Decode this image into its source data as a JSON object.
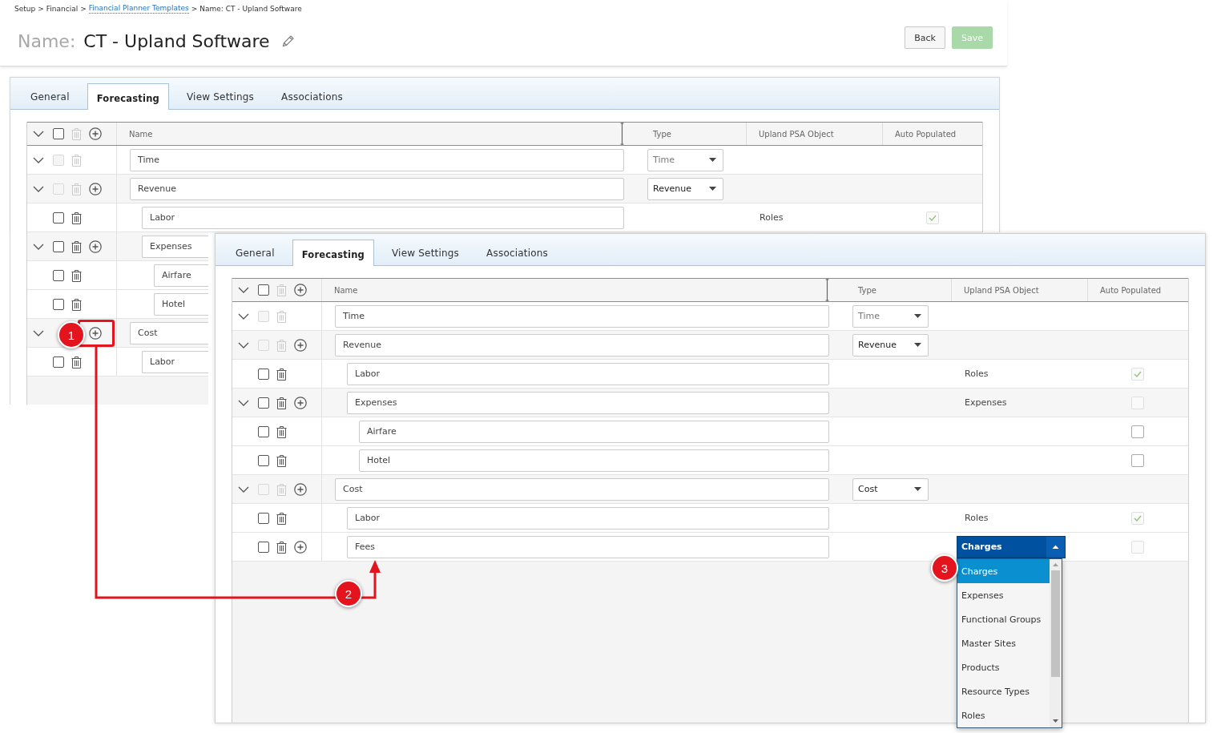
{
  "breadcrumb": [
    {
      "kind": "text",
      "text": "Setup"
    },
    {
      "kind": "separator",
      "text": ">"
    },
    {
      "kind": "text",
      "text": "Financial"
    },
    {
      "kind": "separator",
      "text": ">"
    },
    {
      "kind": "link",
      "text": "Financial Planner Templates"
    },
    {
      "kind": "separator",
      "text": ">"
    },
    {
      "kind": "text",
      "text": "Name: CT - Upland Software"
    }
  ],
  "title": {
    "label": "Name:",
    "value": "CT - Upland Software"
  },
  "buttons": [
    {
      "label": "Back",
      "kind": "secondary",
      "disabled": false
    },
    {
      "label": "Save",
      "kind": "primary",
      "disabled": true
    }
  ],
  "panels": [
    {
      "tabs": [
        {
          "label": "General",
          "selected": false
        },
        {
          "label": "Forecasting",
          "selected": true
        },
        {
          "label": "View Settings",
          "selected": false
        },
        {
          "label": "Associations",
          "selected": false
        }
      ],
      "columns": [
        "Name",
        "Type",
        "Upland PSA Object",
        "Auto Populated"
      ],
      "header_controls": {
        "expanded": true,
        "checkbox": {
          "checked": false,
          "disabled": false
        },
        "trash": {
          "disabled": true
        },
        "add": true
      },
      "rows": [
        {
          "name": "Time",
          "expanded": true,
          "checkbox": {
            "checked": false,
            "disabled": true
          },
          "trash": {
            "disabled": true
          },
          "add": false,
          "type": {
            "value": "Time",
            "disabled": true
          }
        },
        {
          "name": "Revenue",
          "expanded": true,
          "checkbox": {
            "checked": false,
            "disabled": true
          },
          "trash": {
            "disabled": true
          },
          "add": true,
          "type": {
            "value": "Revenue",
            "disabled": false
          },
          "children": [
            {
              "name": "Labor",
              "checkbox": {
                "checked": false,
                "disabled": false
              },
              "trash": {
                "disabled": false
              },
              "add": false,
              "psa_object": "Roles",
              "auto_populated": {
                "checked": true,
                "disabled": true
              }
            },
            {
              "name": "Expenses",
              "expanded": true,
              "checkbox": {
                "checked": false,
                "disabled": false
              },
              "trash": {
                "disabled": false
              },
              "add": true,
              "children": [
                {
                  "name": "Airfare",
                  "checkbox": {
                    "checked": false,
                    "disabled": false
                  },
                  "trash": {
                    "disabled": false
                  },
                  "add": false
                },
                {
                  "name": "Hotel",
                  "checkbox": {
                    "checked": false,
                    "disabled": false
                  },
                  "trash": {
                    "disabled": false
                  },
                  "add": false
                }
              ]
            }
          ]
        },
        {
          "name": "Cost",
          "expanded": true,
          "add": true,
          "children": [
            {
              "name": "Labor",
              "checkbox": {
                "checked": false,
                "disabled": false
              },
              "trash": {
                "disabled": false
              },
              "add": false
            }
          ]
        }
      ]
    },
    {
      "tabs": [
        {
          "label": "General",
          "selected": false
        },
        {
          "label": "Forecasting",
          "selected": true
        },
        {
          "label": "View Settings",
          "selected": false
        },
        {
          "label": "Associations",
          "selected": false
        }
      ],
      "columns": [
        "Name",
        "Type",
        "Upland PSA Object",
        "Auto Populated"
      ],
      "header_controls": {
        "expanded": true,
        "checkbox": {
          "checked": false,
          "disabled": false
        },
        "trash": {
          "disabled": true
        },
        "add": true
      },
      "rows": [
        {
          "name": "Time",
          "expanded": true,
          "checkbox": {
            "checked": false,
            "disabled": true
          },
          "trash": {
            "disabled": true
          },
          "add": false,
          "type": {
            "value": "Time",
            "disabled": true
          }
        },
        {
          "name": "Revenue",
          "expanded": true,
          "checkbox": {
            "checked": false,
            "disabled": true
          },
          "trash": {
            "disabled": true
          },
          "add": true,
          "type": {
            "value": "Revenue",
            "disabled": false
          },
          "children": [
            {
              "name": "Labor",
              "checkbox": {
                "checked": false,
                "disabled": false
              },
              "trash": {
                "disabled": false
              },
              "add": false,
              "psa_object": "Roles",
              "auto_populated": {
                "checked": true,
                "disabled": true
              }
            },
            {
              "name": "Expenses",
              "expanded": true,
              "checkbox": {
                "checked": false,
                "disabled": false
              },
              "trash": {
                "disabled": false
              },
              "add": true,
              "psa_object": "Expenses",
              "auto_populated": {
                "checked": false,
                "disabled": true
              },
              "children": [
                {
                  "name": "Airfare",
                  "checkbox": {
                    "checked": false,
                    "disabled": false
                  },
                  "trash": {
                    "disabled": false
                  },
                  "add": false,
                  "auto_populated": {
                    "checked": false,
                    "disabled": false
                  }
                },
                {
                  "name": "Hotel",
                  "checkbox": {
                    "checked": false,
                    "disabled": false
                  },
                  "trash": {
                    "disabled": false
                  },
                  "add": false,
                  "auto_populated": {
                    "checked": false,
                    "disabled": false
                  }
                }
              ]
            }
          ]
        },
        {
          "name": "Cost",
          "expanded": true,
          "checkbox": {
            "checked": false,
            "disabled": true
          },
          "trash": {
            "disabled": true
          },
          "add": true,
          "type": {
            "value": "Cost",
            "disabled": false
          },
          "children": [
            {
              "name": "Labor",
              "checkbox": {
                "checked": false,
                "disabled": false
              },
              "trash": {
                "disabled": false
              },
              "add": false,
              "psa_object": "Roles",
              "auto_populated": {
                "checked": true,
                "disabled": true
              }
            },
            {
              "name": "Fees",
              "checkbox": {
                "checked": false,
                "disabled": false
              },
              "trash": {
                "disabled": false
              },
              "add": true,
              "psa_select": {
                "value": "Charges",
                "open": true,
                "options": [
                  {
                    "label": "Charges",
                    "selected": true
                  },
                  {
                    "label": "Expenses",
                    "selected": false
                  },
                  {
                    "label": "Functional Groups",
                    "selected": false
                  },
                  {
                    "label": "Master Sites",
                    "selected": false
                  },
                  {
                    "label": "Products",
                    "selected": false
                  },
                  {
                    "label": "Resource Types",
                    "selected": false
                  },
                  {
                    "label": "Roles",
                    "selected": false
                  }
                ]
              },
              "auto_populated": {
                "checked": false,
                "disabled": true
              }
            }
          ]
        }
      ]
    }
  ],
  "markers": [
    "1",
    "2",
    "3"
  ]
}
